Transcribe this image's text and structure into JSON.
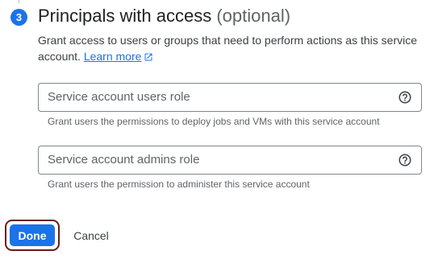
{
  "step": {
    "number": "3",
    "title": "Principals with access",
    "title_suffix": "(optional)"
  },
  "description": {
    "text": "Grant access to users or groups that need to perform actions as this service account.",
    "link_label": "Learn more"
  },
  "fields": [
    {
      "placeholder": "Service account users role",
      "hint": "Grant users the permissions to deploy jobs and VMs with this service account"
    },
    {
      "placeholder": "Service account admins role",
      "hint": "Grant users the permission to administer this service account"
    }
  ],
  "actions": {
    "done_label": "Done",
    "cancel_label": "Cancel"
  },
  "colors": {
    "accent": "#1a73e8",
    "focus_outline": "#6b1a1a"
  },
  "icons": {
    "external_link": "open-in-new-icon",
    "help": "help-circle-icon"
  }
}
